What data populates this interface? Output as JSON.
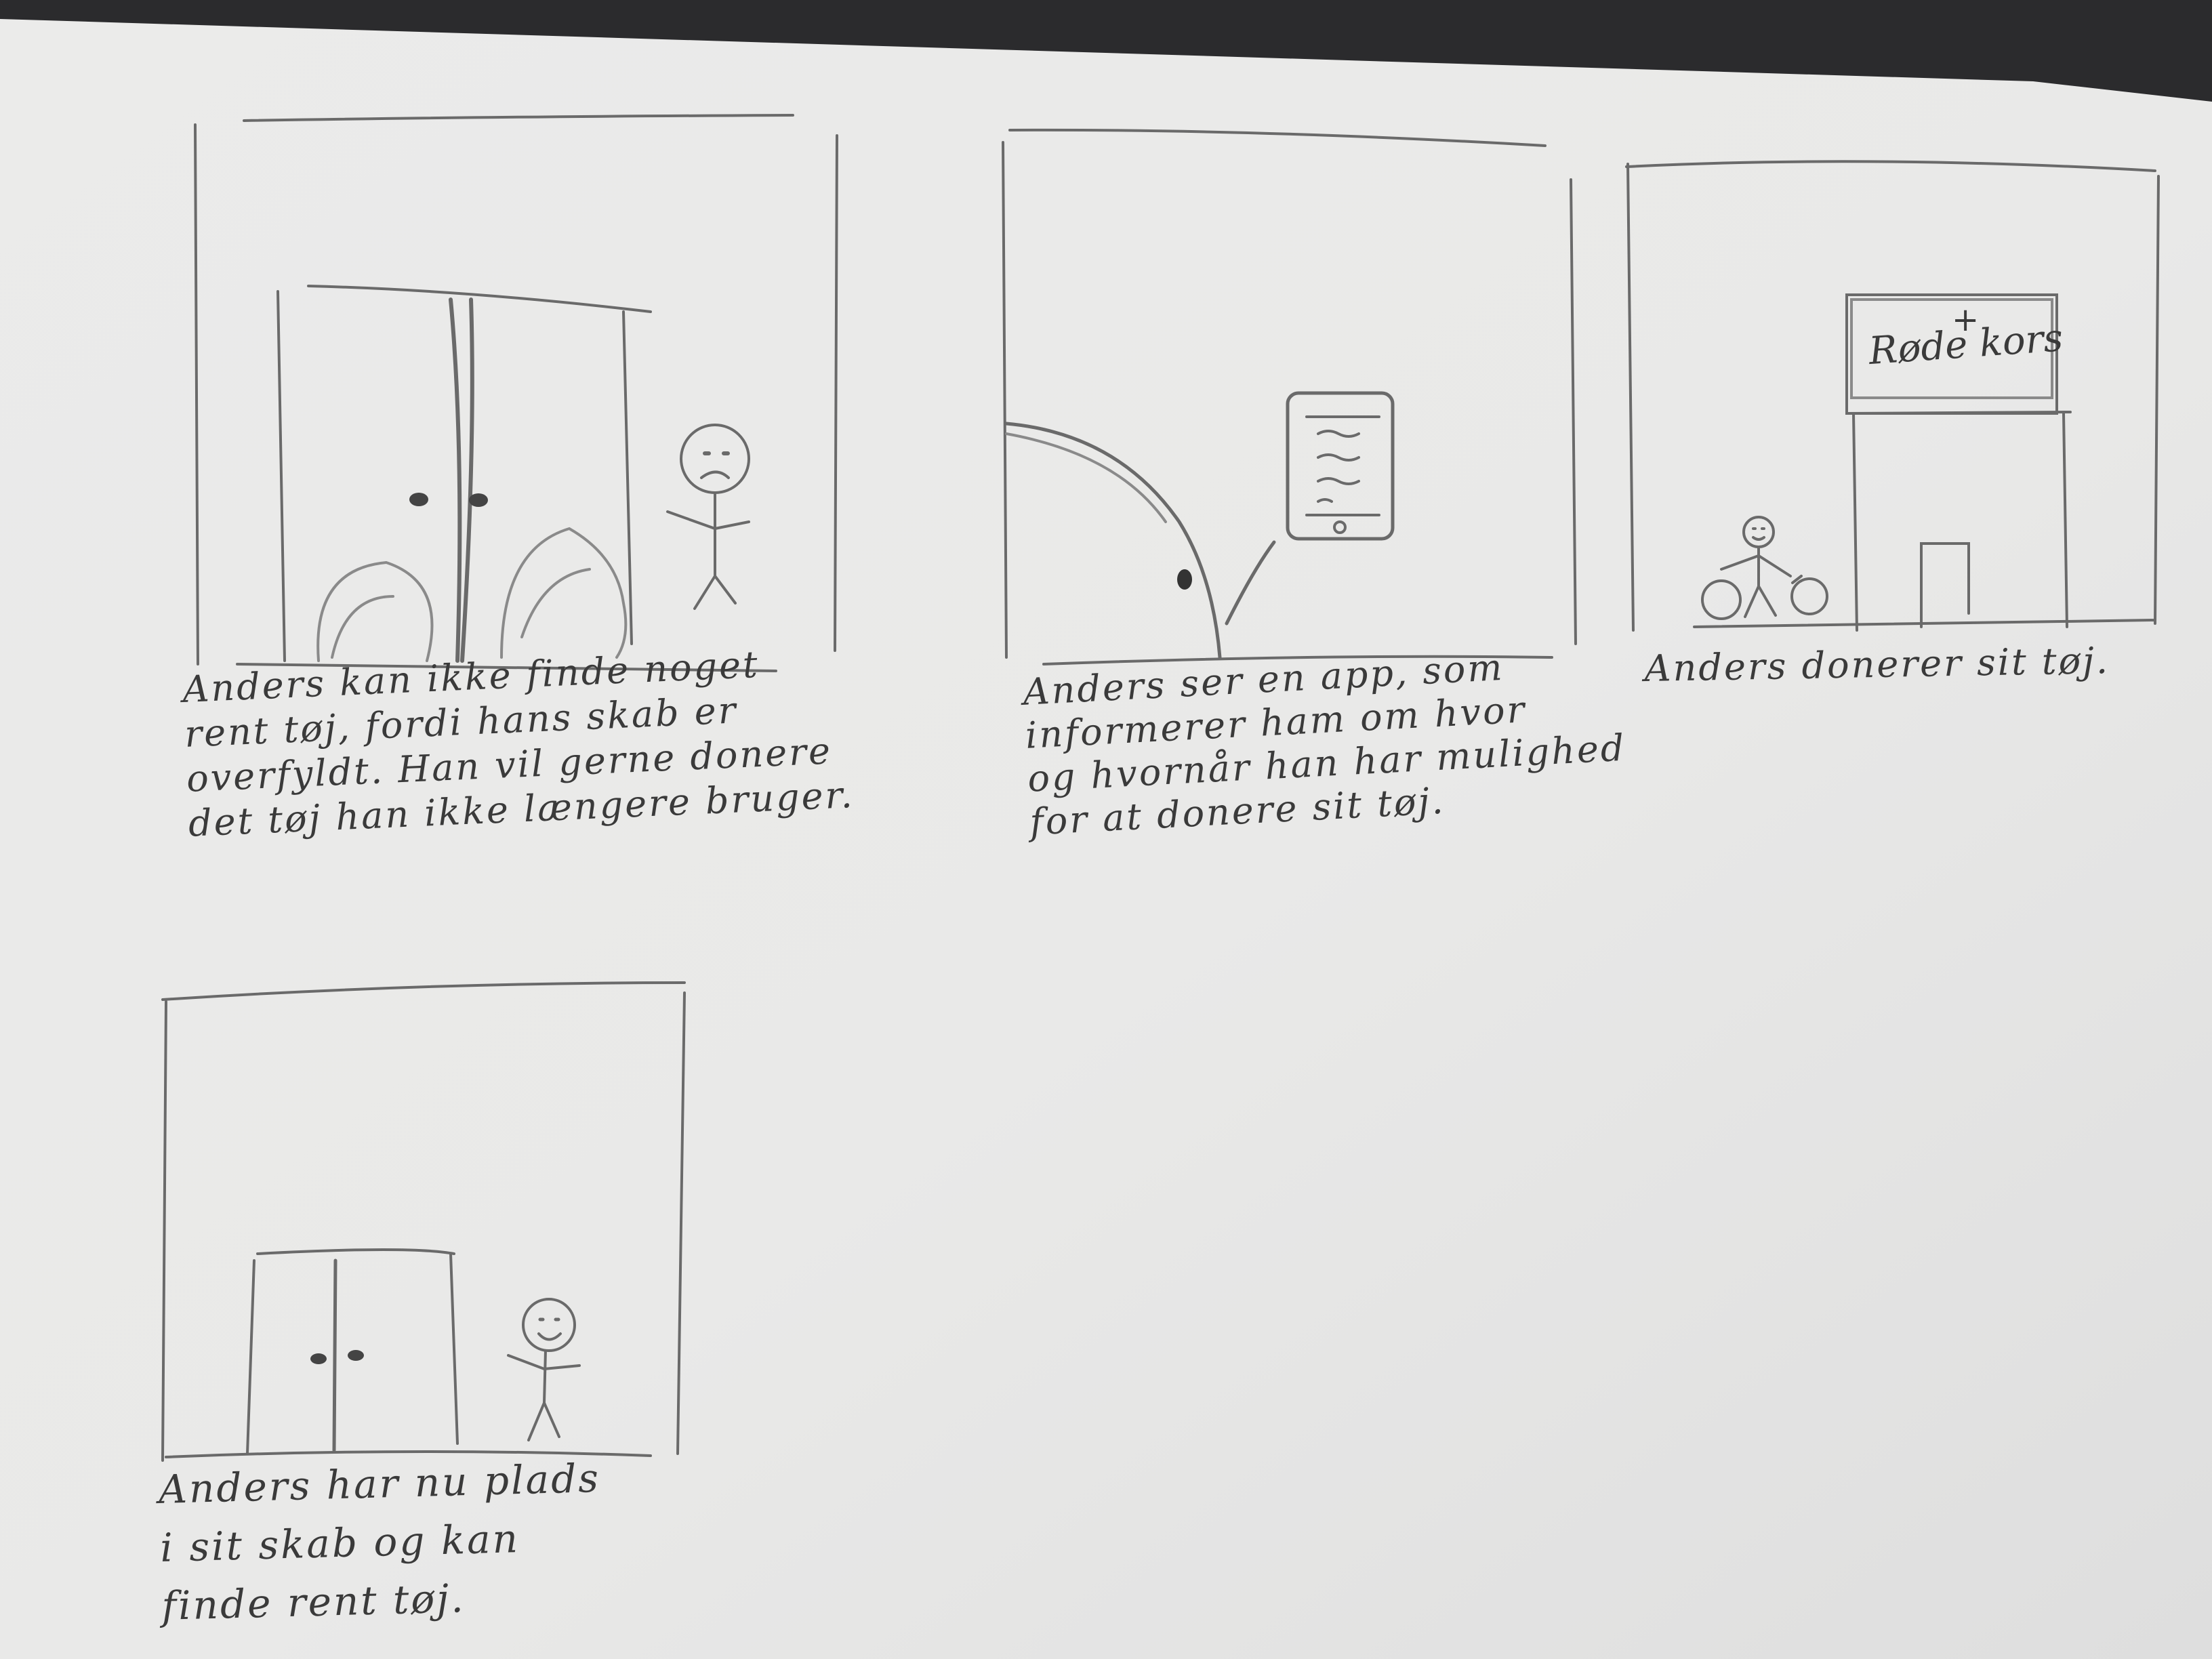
{
  "storyboard": {
    "panels": [
      {
        "id": 1,
        "caption_lines": [
          "Anders kan ikke finde noget",
          "rent tøj, fordi hans skab er",
          "overfyldt. Han vil gerne donere",
          "det tøj han ikke længere bruger."
        ]
      },
      {
        "id": 2,
        "caption_lines": [
          "Anders ser en app, som",
          "informerer ham om hvor",
          "og hvornår han har mulighed",
          "for at donere sit tøj."
        ]
      },
      {
        "id": 3,
        "sign_text": "Røde kors",
        "caption_lines": [
          "Anders donerer sit tøj."
        ]
      },
      {
        "id": 4,
        "caption_lines": [
          "Anders har nu plads",
          "i sit skab og kan",
          "finde rent tøj."
        ]
      }
    ]
  }
}
